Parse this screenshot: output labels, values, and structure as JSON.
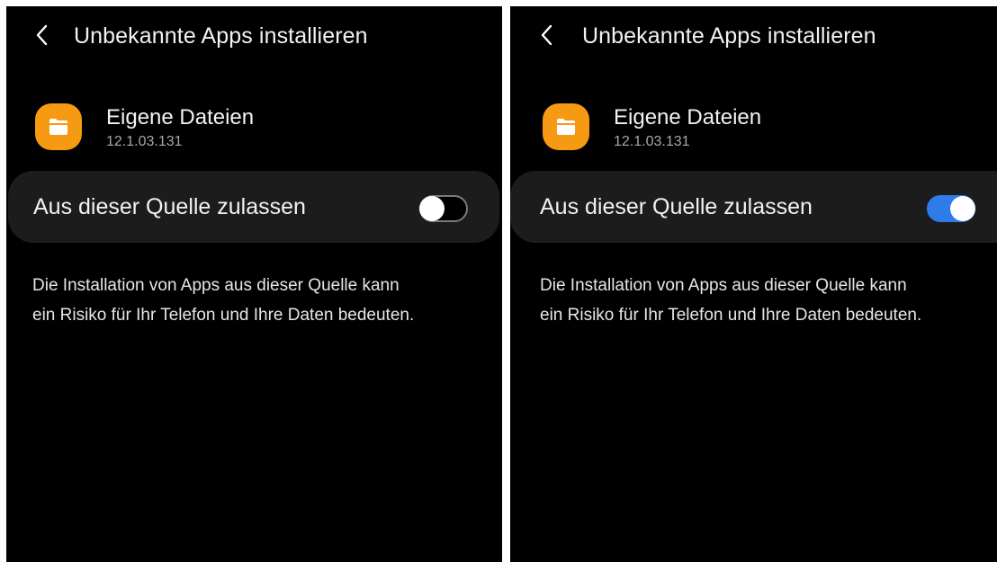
{
  "colors": {
    "background": "#000000",
    "card": "#1c1c1c",
    "app_icon": "#f59a12",
    "switch_on": "#2f7be8",
    "switch_off_border": "#7a7a7a",
    "divider": "#ffffff"
  },
  "screens": [
    {
      "header": {
        "back_icon": "chevron-left-icon",
        "title": "Unbekannte Apps installieren"
      },
      "app": {
        "icon": "folder-icon",
        "name": "Eigene Dateien",
        "version": "12.1.03.131"
      },
      "toggle": {
        "label": "Aus dieser Quelle zulassen",
        "state": "off"
      },
      "warning": {
        "line1": "Die Installation von Apps aus dieser Quelle kann",
        "line2": "ein Risiko für Ihr Telefon und Ihre Daten bedeuten."
      }
    },
    {
      "header": {
        "back_icon": "chevron-left-icon",
        "title": "Unbekannte Apps installieren"
      },
      "app": {
        "icon": "folder-icon",
        "name": "Eigene Dateien",
        "version": "12.1.03.131"
      },
      "toggle": {
        "label": "Aus dieser Quelle zulassen",
        "state": "on"
      },
      "warning": {
        "line1": "Die Installation von Apps aus dieser Quelle kann",
        "line2": "ein Risiko für Ihr Telefon und Ihre Daten bedeuten."
      }
    }
  ]
}
